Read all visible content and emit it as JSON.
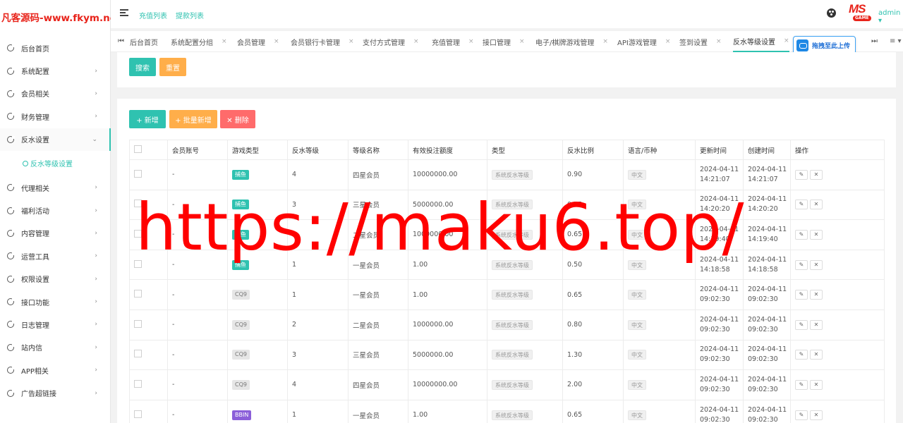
{
  "site": {
    "logo_text": "凡客源码-www.fkym.net"
  },
  "sidebar": {
    "items": [
      {
        "label": "后台首页",
        "chevron": ""
      },
      {
        "label": "系统配置",
        "chevron": "›"
      },
      {
        "label": "会员相关",
        "chevron": "›"
      },
      {
        "label": "财务管理",
        "chevron": "›"
      },
      {
        "label": "反水设置",
        "chevron": "⌄"
      },
      {
        "label": "代理相关",
        "chevron": "›"
      },
      {
        "label": "福利活动",
        "chevron": "›"
      },
      {
        "label": "内容管理",
        "chevron": "›"
      },
      {
        "label": "运营工具",
        "chevron": "›"
      },
      {
        "label": "权限设置",
        "chevron": "›"
      },
      {
        "label": "接口功能",
        "chevron": "›"
      },
      {
        "label": "日志管理",
        "chevron": "›"
      },
      {
        "label": "站内信",
        "chevron": "›"
      },
      {
        "label": "APP相关",
        "chevron": "›"
      },
      {
        "label": "广告超链接",
        "chevron": "›"
      }
    ],
    "subitem": "反水等级设置"
  },
  "header": {
    "links": [
      "充值列表",
      "提款列表"
    ],
    "brand_top": "MS",
    "brand_bottom": "GAME",
    "user": "admin ▾"
  },
  "tabs": {
    "first_icon": "⏮",
    "last_icon": "⏭",
    "menu_icon": "≡ ▾",
    "items": [
      {
        "label": "后台首页",
        "close": ""
      },
      {
        "label": "系统配置分组",
        "close": "×"
      },
      {
        "label": "会员管理",
        "close": "×"
      },
      {
        "label": "会员银行卡管理",
        "close": "×"
      },
      {
        "label": "支付方式管理",
        "close": "×"
      },
      {
        "label": "充值管理",
        "close": "×"
      },
      {
        "label": "接口管理",
        "close": "×"
      },
      {
        "label": "电子/棋牌游戏管理",
        "close": "×"
      },
      {
        "label": "API游戏管理",
        "close": "×"
      },
      {
        "label": "签到设置",
        "close": "×"
      },
      {
        "label": "反水等级设置",
        "close": "×"
      }
    ],
    "upload_label": "拖拽至此上传"
  },
  "search": {
    "search_label": "搜索",
    "reset_label": "重置"
  },
  "toolbar": {
    "add_label": "+ 新增",
    "batch_add_label": "+ 批量新增",
    "delete_label": "✕ 删除"
  },
  "table": {
    "columns": [
      "会员账号",
      "游戏类型",
      "反水等级",
      "等级名称",
      "有效投注额度",
      "类型",
      "反水比例",
      "语言/币种",
      "更新时间",
      "创建时间",
      "操作"
    ],
    "rows": [
      {
        "account": "-",
        "game": "捕鱼",
        "game_style": "fish",
        "level": "4",
        "name": "四星会员",
        "amount": "10000000.00",
        "type": "系统反水等级",
        "ratio": "0.90",
        "lang": "中文",
        "upd_date": "2024-04-11",
        "upd_time": "14:21:07",
        "cre_date": "2024-04-11",
        "cre_time": "14:21:07"
      },
      {
        "account": "-",
        "game": "捕鱼",
        "game_style": "fish",
        "level": "3",
        "name": "三星会员",
        "amount": "5000000.00",
        "type": "系统反水等级",
        "ratio": "0.75",
        "lang": "中文",
        "upd_date": "2024-04-11",
        "upd_time": "14:20:20",
        "cre_date": "2024-04-11",
        "cre_time": "14:20:20"
      },
      {
        "account": "-",
        "game": "捕鱼",
        "game_style": "fish",
        "level": "2",
        "name": "二星会员",
        "amount": "1000000.00",
        "type": "系统反水等级",
        "ratio": "0.65",
        "lang": "中文",
        "upd_date": "2024-04-11",
        "upd_time": "14:19:40",
        "cre_date": "2024-04-11",
        "cre_time": "14:19:40"
      },
      {
        "account": "-",
        "game": "捕鱼",
        "game_style": "fish",
        "level": "1",
        "name": "一星会员",
        "amount": "1.00",
        "type": "系统反水等级",
        "ratio": "0.50",
        "lang": "中文",
        "upd_date": "2024-04-11",
        "upd_time": "14:18:58",
        "cre_date": "2024-04-11",
        "cre_time": "14:18:58"
      },
      {
        "account": "-",
        "game": "CQ9",
        "game_style": "cq9",
        "level": "1",
        "name": "一星会员",
        "amount": "1.00",
        "type": "系统反水等级",
        "ratio": "0.65",
        "lang": "中文",
        "upd_date": "2024-04-11",
        "upd_time": "09:02:30",
        "cre_date": "2024-04-11",
        "cre_time": "09:02:30"
      },
      {
        "account": "-",
        "game": "CQ9",
        "game_style": "cq9",
        "level": "2",
        "name": "二星会员",
        "amount": "1000000.00",
        "type": "系统反水等级",
        "ratio": "0.80",
        "lang": "中文",
        "upd_date": "2024-04-11",
        "upd_time": "09:02:30",
        "cre_date": "2024-04-11",
        "cre_time": "09:02:30"
      },
      {
        "account": "-",
        "game": "CQ9",
        "game_style": "cq9",
        "level": "3",
        "name": "三星会员",
        "amount": "5000000.00",
        "type": "系统反水等级",
        "ratio": "1.30",
        "lang": "中文",
        "upd_date": "2024-04-11",
        "upd_time": "09:02:30",
        "cre_date": "2024-04-11",
        "cre_time": "09:02:30"
      },
      {
        "account": "-",
        "game": "CQ9",
        "game_style": "cq9",
        "level": "4",
        "name": "四星会员",
        "amount": "10000000.00",
        "type": "系统反水等级",
        "ratio": "2.00",
        "lang": "中文",
        "upd_date": "2024-04-11",
        "upd_time": "09:02:30",
        "cre_date": "2024-04-11",
        "cre_time": "09:02:30"
      },
      {
        "account": "-",
        "game": "BBIN",
        "game_style": "bbin",
        "level": "1",
        "name": "一星会员",
        "amount": "1.00",
        "type": "系统反水等级",
        "ratio": "0.65",
        "lang": "中文",
        "upd_date": "2024-04-11",
        "upd_time": "09:02:30",
        "cre_date": "2024-04-11",
        "cre_time": "09:02:30"
      }
    ],
    "edit_icon": "✎",
    "delete_icon": "✕"
  },
  "watermark": {
    "text": "https://maku6.top/"
  },
  "colors": {
    "accent": "#2fc2b0",
    "orange": "#ffae4a",
    "red": "#ff6b6b",
    "bbin": "#8b5fd9",
    "logo": "#e8231a"
  }
}
